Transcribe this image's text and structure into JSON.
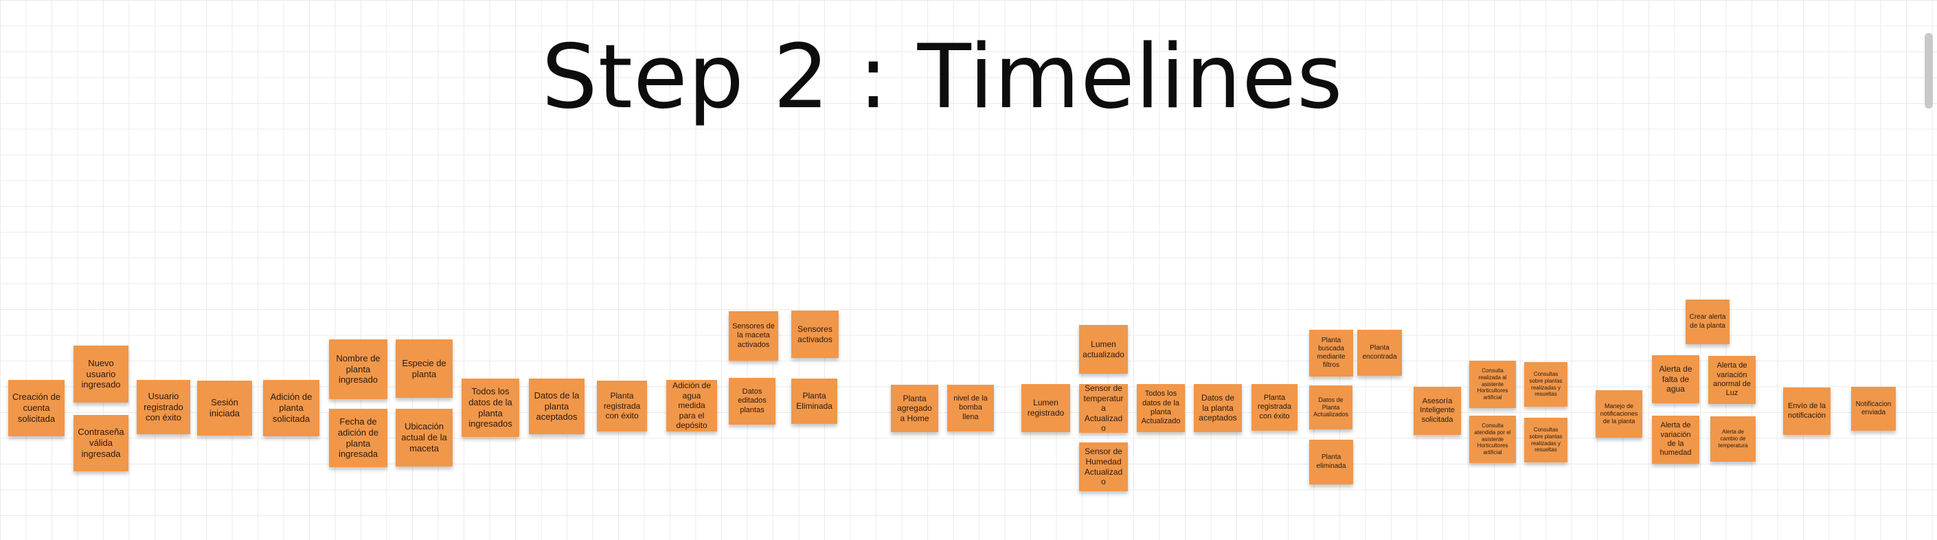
{
  "board": {
    "title": "Step 2 : Timelines",
    "note_color": "#f0974a",
    "stickies": [
      "Creación de cuenta solicitada",
      "Nuevo usuario ingresado",
      "Contraseña válida ingresada",
      "Usuario registrado con éxito",
      "Sesión iniciada",
      "Adición de planta solicitada",
      "Nombre de planta ingresado",
      "Fecha de adición de planta ingresada",
      "Especie de planta",
      "Ubicación actual de la maceta",
      "Todos los datos de la planta ingresados",
      "Datos de la planta aceptados",
      "Planta registrada con éxito",
      "Adición de agua medida para el depósito",
      "Sensores de la maceta activados",
      "Datos editados plantas",
      "Sensores activados",
      "Planta Eliminada",
      "Planta agregado a Home",
      "nivel de la bomba llena",
      "Lumen registrado",
      "Lumen actualizado",
      "Sensor de temperatura Actualizado",
      "Sensor de Humedad Actualizado",
      "Todos los datos de la planta Actualizado",
      "Datos de la planta aceptados",
      "Planta registrada con éxito",
      "Planta buscada mediante filtros",
      "Datos de Planta Actualizados",
      "Planta eliminada",
      "Planta encontrada",
      "Asesoría Inteligente solicitada",
      "Consulta realizada al asistente Horticultores artificial",
      "Consulta atendida por el asistente Horticultores artificial",
      "Consultas sobre plantas realizadas y resueltas",
      "Consultas sobre plantas realizadas y resueltas",
      "Manejo de notificaciones de la planta",
      "Alerta de falta de agua",
      "Alerta de variación de la humedad",
      "Crear alerta de la planta",
      "Alerta de variación anormal de Luz",
      "Alerta de cambio de temperatura",
      "Envío de la notificación",
      "Notificacion enviada"
    ]
  }
}
